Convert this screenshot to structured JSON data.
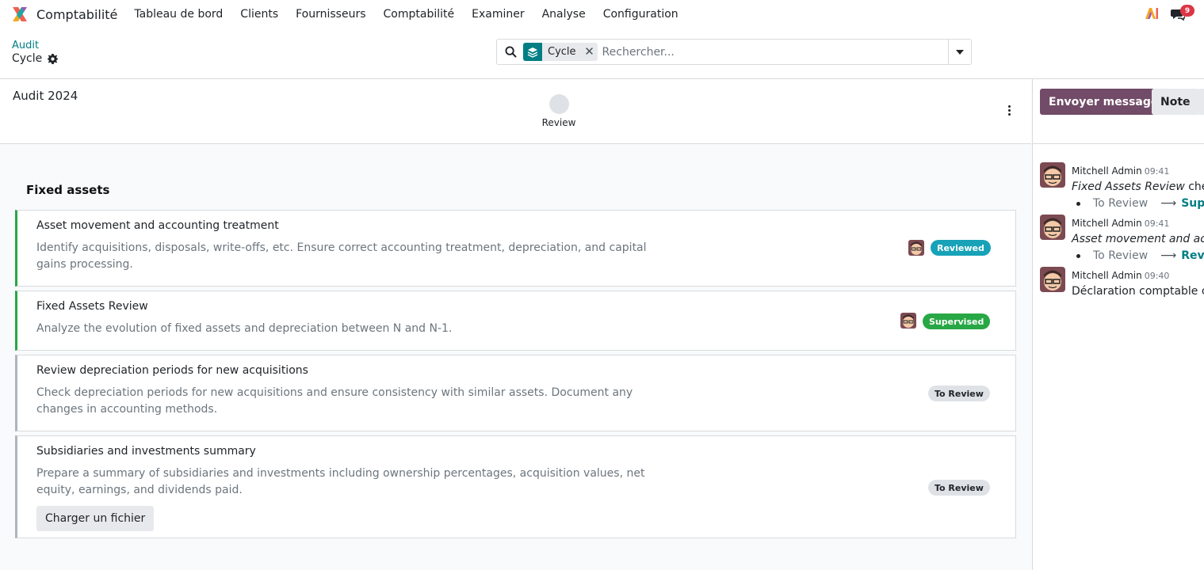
{
  "app": {
    "name": "Comptabilité"
  },
  "menu": [
    "Tableau de bord",
    "Clients",
    "Fournisseurs",
    "Comptabilité",
    "Examiner",
    "Analyse",
    "Configuration"
  ],
  "nav": {
    "messages_count": "9"
  },
  "breadcrumb": {
    "parent": "Audit",
    "current": "Cycle"
  },
  "search": {
    "facet_label": "Cycle",
    "placeholder": "Rechercher..."
  },
  "record": {
    "title": "Audit 2024",
    "stage": "Review"
  },
  "section": {
    "title": "Fixed assets"
  },
  "tasks": [
    {
      "title": "Asset movement and accounting treatment",
      "desc": "Identify acquisitions, disposals, write-offs, etc. Ensure correct accounting treatment, depreciation, and capital gains processing.",
      "status": "Reviewed"
    },
    {
      "title": "Fixed Assets Review",
      "desc": "Analyze the evolution of fixed assets and depreciation between N and N-1.",
      "status": "Supervised"
    },
    {
      "title": "Review depreciation periods for new acquisitions",
      "desc": "Check depreciation periods for new acquisitions and ensure consistency with similar assets. Document any changes in accounting methods.",
      "status": "To Review"
    },
    {
      "title": "Subsidiaries and investments summary",
      "desc": "Prepare a summary of subsidiaries and investments including ownership percentages, acquisition values, net equity, earnings, and dividends paid.",
      "status": "To Review",
      "upload_label": "Charger un fichier"
    }
  ],
  "chatter": {
    "send_label": "Envoyer message",
    "note_label": "Note",
    "messages": [
      {
        "author": "Mitchell Admin",
        "time": "09:41",
        "subject": "Fixed Assets Review",
        "text": " check",
        "old": "To Review",
        "new": "Super"
      },
      {
        "author": "Mitchell Admin",
        "time": "09:41",
        "subject": "Asset movement and acco",
        "text": "",
        "old": "To Review",
        "new": "Revie"
      },
      {
        "author": "Mitchell Admin",
        "time": "09:40",
        "subject": "",
        "text": "Déclaration comptable cré"
      }
    ]
  },
  "colors": {
    "brand": "#714b67",
    "link": "#017e84",
    "reviewed": "#17a2b8",
    "supervised": "#28a745",
    "danger": "#dc3545"
  }
}
